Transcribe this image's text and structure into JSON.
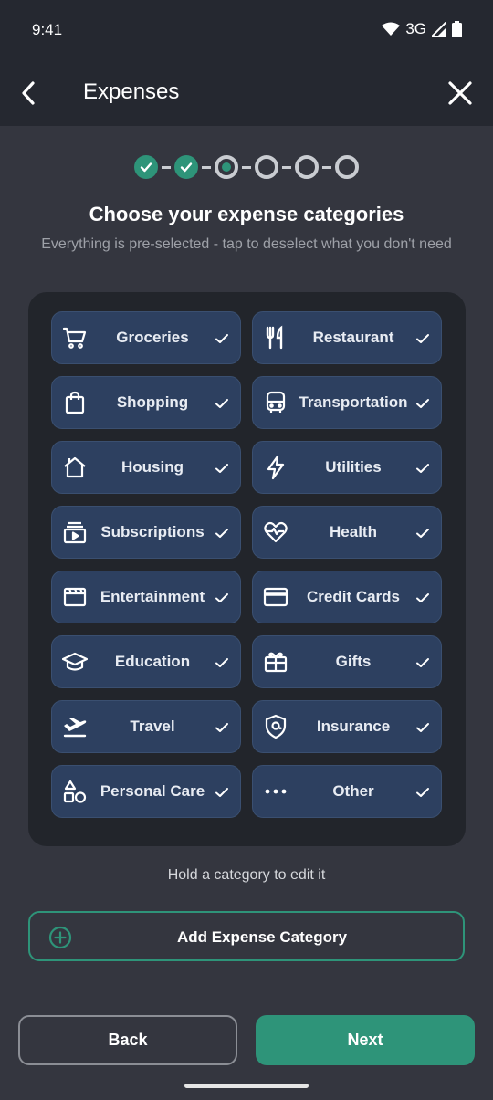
{
  "status_bar": {
    "time": "9:41",
    "network": "3G"
  },
  "appbar": {
    "title": "Expenses"
  },
  "stepper": {
    "steps": [
      "done",
      "done",
      "current",
      "todo",
      "todo",
      "todo"
    ]
  },
  "heading": "Choose your expense categories",
  "subheading": "Everything is pre-selected - tap to deselect what you don't need",
  "categories": [
    {
      "label": "Groceries",
      "icon": "cart-icon",
      "selected": true
    },
    {
      "label": "Restaurant",
      "icon": "fork-knife-icon",
      "selected": true
    },
    {
      "label": "Shopping",
      "icon": "shopping-bag-icon",
      "selected": true
    },
    {
      "label": "Transportation",
      "icon": "bus-icon",
      "selected": true
    },
    {
      "label": "Housing",
      "icon": "house-icon",
      "selected": true
    },
    {
      "label": "Utilities",
      "icon": "lightning-icon",
      "selected": true
    },
    {
      "label": "Subscriptions",
      "icon": "subscriptions-icon",
      "selected": true
    },
    {
      "label": "Health",
      "icon": "heart-pulse-icon",
      "selected": true
    },
    {
      "label": "Entertainment",
      "icon": "clapperboard-icon",
      "selected": true
    },
    {
      "label": "Credit Cards",
      "icon": "credit-card-icon",
      "selected": true
    },
    {
      "label": "Education",
      "icon": "graduation-cap-icon",
      "selected": true
    },
    {
      "label": "Gifts",
      "icon": "gift-icon",
      "selected": true
    },
    {
      "label": "Travel",
      "icon": "airplane-icon",
      "selected": true
    },
    {
      "label": "Insurance",
      "icon": "shield-icon",
      "selected": true
    },
    {
      "label": "Personal Care",
      "icon": "shapes-icon",
      "selected": true
    },
    {
      "label": "Other",
      "icon": "more-dots-icon",
      "selected": true
    }
  ],
  "hint": "Hold a category to edit it",
  "add_button": {
    "label": "Add Expense Category",
    "icon": "plus-circle-icon"
  },
  "footer": {
    "back_label": "Back",
    "next_label": "Next"
  },
  "colors": {
    "accent": "#2e9479",
    "chip_bg": "#2d4060",
    "panel_bg": "#22252b",
    "page_bg": "#34363f",
    "bar_bg": "#252830"
  }
}
